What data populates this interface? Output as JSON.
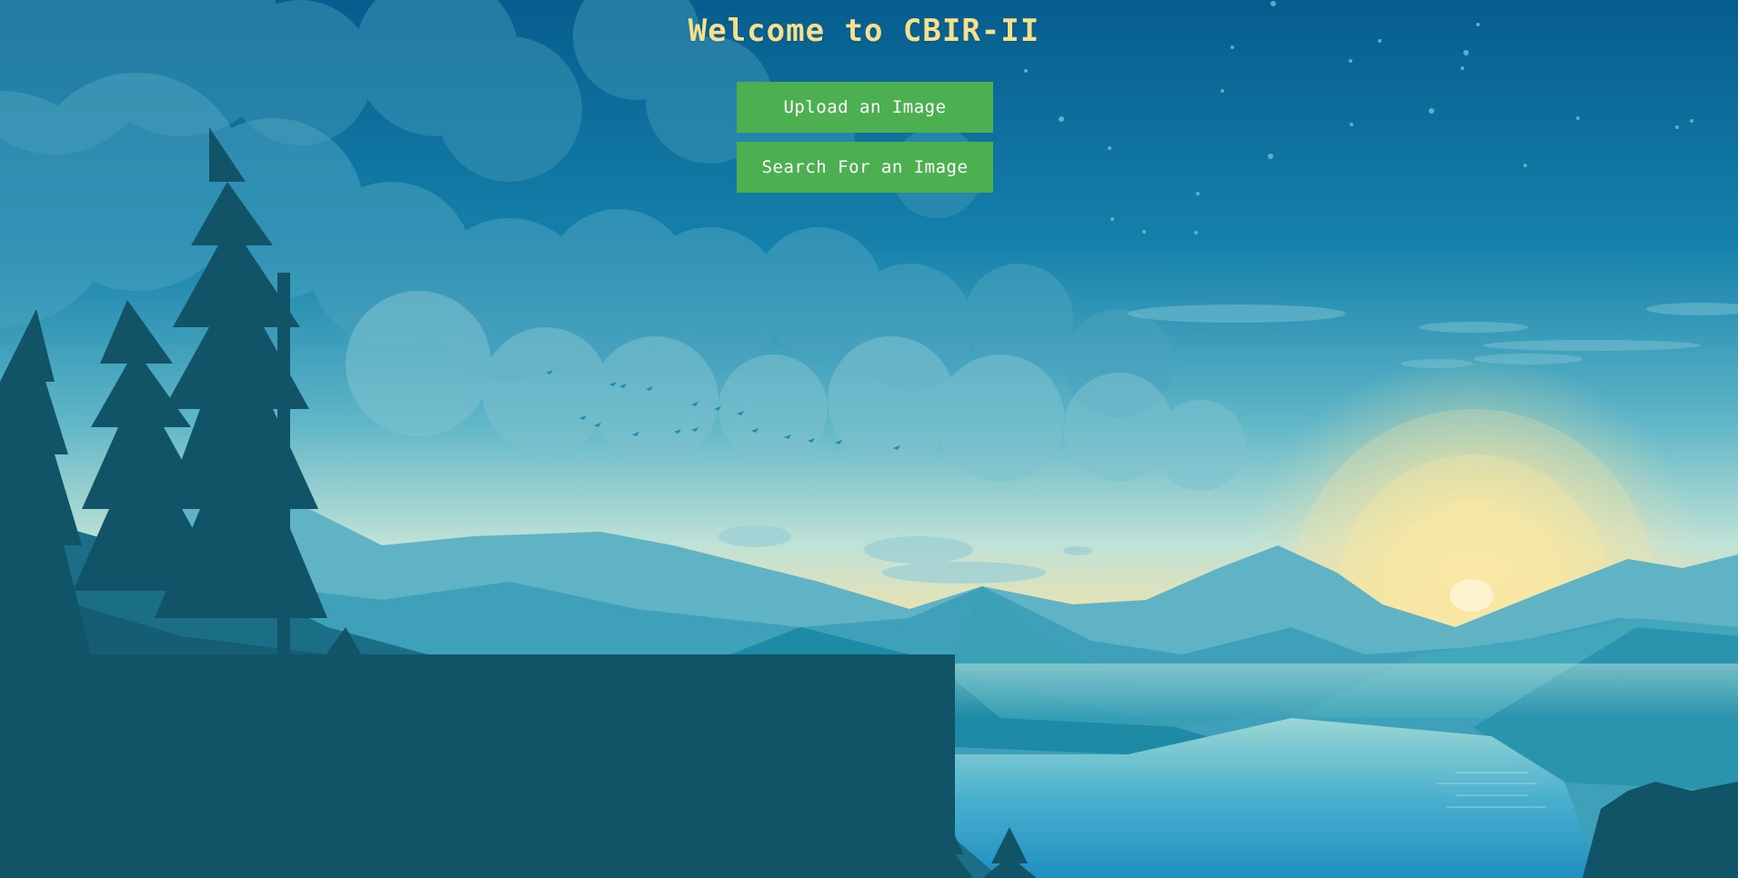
{
  "page": {
    "title": "Welcome to CBIR-II"
  },
  "actions": {
    "upload_label": "Upload an Image",
    "search_label": "Search For an Image"
  },
  "theme": {
    "title_color": "#f5e08d",
    "button_color": "#4caf50",
    "button_text_color": "#ffffff",
    "sky_top": "#0b5e8a",
    "sky_horizon": "#f6e6a6",
    "forest_dark": "#125467"
  },
  "background": {
    "description_icon": "mountain-lake-sunrise-illustration"
  }
}
